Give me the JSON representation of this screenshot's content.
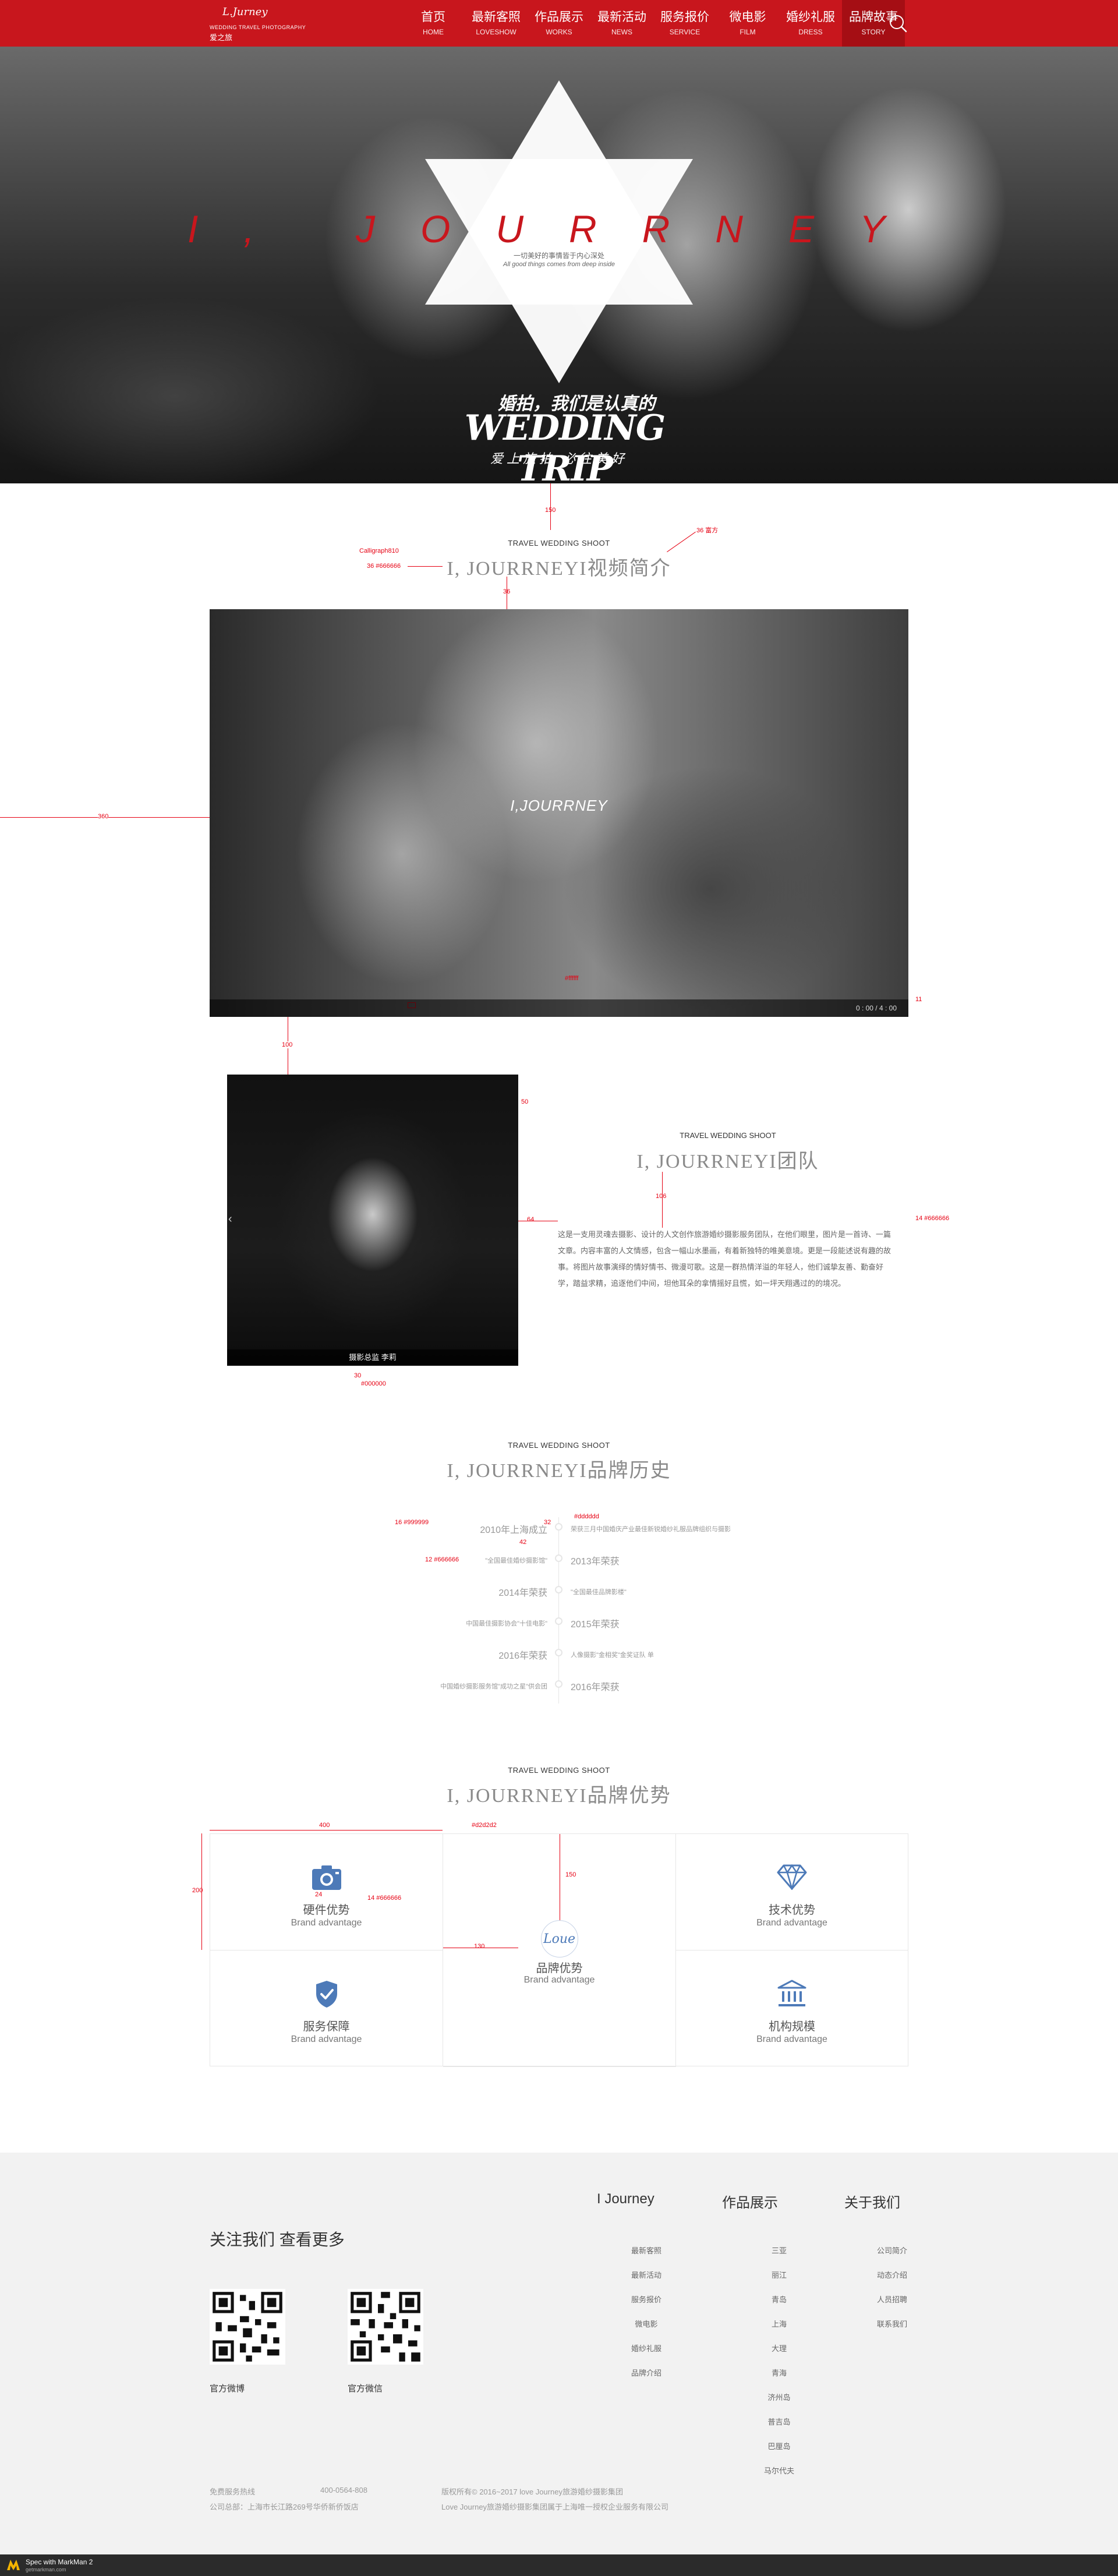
{
  "brand": {
    "logo_mark": "L.Jurney",
    "logo_en": "WEDDING TRAVEL PHOTOGRAPHY",
    "logo_cn": "爱之旅"
  },
  "nav": [
    {
      "cn": "首页",
      "en": "HOME"
    },
    {
      "cn": "最新客照",
      "en": "LOVESHOW"
    },
    {
      "cn": "作品展示",
      "en": "WORKS"
    },
    {
      "cn": "最新活动",
      "en": "NEWS"
    },
    {
      "cn": "服务报价",
      "en": "SERVICE"
    },
    {
      "cn": "微电影",
      "en": "FILM"
    },
    {
      "cn": "婚纱礼服",
      "en": "DRESS"
    },
    {
      "cn": "品牌故事",
      "en": "STORY"
    }
  ],
  "hero": {
    "title": "I, JOURRNEY",
    "sub_cn": "一切美好的事情皆于内心深处",
    "sub_en": "All good things comes from deep inside",
    "slogan_cn": "婚拍，我们是认真的",
    "slogan_en": "WEDDING TRIP",
    "tagline": "爱上旅拍 必往美好"
  },
  "video_section": {
    "en": "TRAVEL WEDDING SHOOT",
    "cn": "I, JOURRNEYI视频简介",
    "video_title": "I,JOURRNEY",
    "time": "0 : 00 / 4 : 00"
  },
  "team_section": {
    "en": "TRAVEL WEDDING SHOOT",
    "cn": "I, JOURRNEYI团队",
    "caption": "摄影总监  李莉",
    "body": "这是一支用灵魂去摄影、设计的人文创作旅游婚纱摄影服务团队，在他们眼里，图片是一首诗、一篇文章。内容丰富的人文情感，包含一幅山水墨画，有着新独特的唯美意境。更是一段能述说有趣的故事。将图片故事演绎的情好情书、微漫可歌。这是一群热情洋溢的年轻人，他们诚挚友善、勤奋好学，踏益求精，追逐他们中间，坦他耳朵的拿情摇好且慌，如一坪天翔遇过的的境况。"
  },
  "history_section": {
    "en": "TRAVEL WEDDING SHOOT",
    "cn": "I, JOURRNEYI品牌历史",
    "rows": [
      {
        "side": "left",
        "year": "2010年上海成立",
        "note": ""
      },
      {
        "side": "right",
        "year": "",
        "note": "荣获三月中国婚庆产业最佳新锐婚纱礼服品牌组织与摄影"
      },
      {
        "side": "left",
        "year": "",
        "note": "\"全国最佳婚纱摄影馆\""
      },
      {
        "side": "right",
        "year": "2013年荣获",
        "note": ""
      },
      {
        "side": "left",
        "year": "2014年荣获",
        "note": ""
      },
      {
        "side": "right",
        "year": "",
        "note": "\"全国最佳品牌影楼\""
      },
      {
        "side": "left",
        "year": "",
        "note": "中国最佳摄影协会\"十佳电影\""
      },
      {
        "side": "right",
        "year": "2015年荣获",
        "note": ""
      },
      {
        "side": "left",
        "year": "2016年荣获",
        "note": ""
      },
      {
        "side": "right",
        "year": "",
        "note": "人像摄影\"金相奖\"金奖证队 单"
      },
      {
        "side": "left",
        "year": "",
        "note": "中国婚纱摄影服务馆\"成功之星\"供会团"
      },
      {
        "side": "right",
        "year": "2016年荣获",
        "note": ""
      }
    ]
  },
  "advantage_section": {
    "en": "TRAVEL WEDDING SHOOT",
    "cn": "I, JOURRNEYI品牌优势",
    "cells": [
      {
        "title": "硬件优势",
        "en": "Brand advantage",
        "icon": "camera-icon"
      },
      {
        "title": "品牌优势",
        "en": "Brand advantage",
        "icon": "brand-logo-icon"
      },
      {
        "title": "技术优势",
        "en": "Brand advantage",
        "icon": "diamond-icon"
      },
      {
        "title": "服务保障",
        "en": "Brand advantage",
        "icon": "shield-check-icon"
      },
      {
        "title": "机构规模",
        "en": "Brand advantage",
        "icon": "building-icon"
      }
    ],
    "center_logo": "Loue"
  },
  "footer": {
    "follow_title": "关注我们 查看更多",
    "qr1_label": "官方微博",
    "qr2_label": "官方微信",
    "col1": {
      "title": "I Journey",
      "links": [
        "最新客照",
        "最新活动",
        "服务报价",
        "微电影",
        "婚纱礼服",
        "品牌介绍"
      ]
    },
    "col2": {
      "title": "作品展示",
      "links": [
        "三亚",
        "丽江",
        "青岛",
        "上海",
        "大理",
        "青海",
        "济州岛",
        "普吉岛",
        "巴厘岛",
        "马尔代夫"
      ]
    },
    "col3": {
      "title": "关于我们",
      "links": [
        "公司简介",
        "动态介绍",
        "人员招聘",
        "联系我们"
      ]
    },
    "hotline_label": "免费服务热线",
    "hotline": "400-0564-808",
    "address": "公司总部：上海市长江路269号华侨新侨饭店",
    "copyright": "版权所有© 2016~2017 love Journey旅游婚纱摄影集团",
    "copyright2": "Love Journey旅游婚纱摄影集团属于上海唯一授权企业服务有限公司"
  },
  "spec_bar": {
    "text": "Spec with MarkMan 2",
    "sub": "getmarkman.com"
  },
  "annotations": {
    "a150": "150",
    "a36": "36",
    "a36b": "36 富方",
    "calli": "Calligraph810",
    "c666": "36  #666666",
    "a360": "360",
    "a11": "11",
    "a100": "100",
    "a50": "50",
    "a30": "30",
    "a106": "106",
    "a14": "14  #666666",
    "a16": "16  #999999",
    "a12": "12  #666666",
    "a32": "32",
    "a42": "42",
    "cd": "#dddddd",
    "a400": "400",
    "a200": "200",
    "a130": "130",
    "a24": "24",
    "ad": "#d2d2d2",
    "a14b": "14  #666666",
    "a64": "64",
    "ff": "#ffffff",
    "c00": "#000000"
  },
  "colors": {
    "brand_red": "#c8161d",
    "accent_blue": "#4d7ab8"
  }
}
